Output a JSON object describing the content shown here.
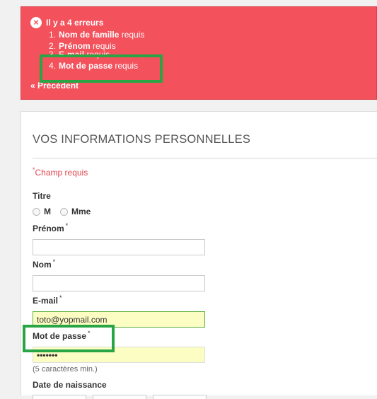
{
  "errors": {
    "header": "Il y a 4 erreurs",
    "items": [
      {
        "num": "1.",
        "field": "Nom de famille",
        "suffix": " requis"
      },
      {
        "num": "2.",
        "field": "Prénom",
        "suffix": " requis"
      },
      {
        "num": "3.",
        "field": "E-mail",
        "suffix": " requis"
      },
      {
        "num": "4.",
        "field": "Mot de passe",
        "suffix": " requis"
      }
    ],
    "back_link": "« Précédent"
  },
  "form": {
    "title": "VOS INFORMATIONS PERSONNELLES",
    "required_note_star": "*",
    "required_note": "Champ requis",
    "titre_label": "Titre",
    "radio_m": "M",
    "radio_mme": "Mme",
    "prenom_label": "Prénom",
    "nom_label": "Nom",
    "email_label": "E-mail",
    "email_value": "toto@yopmail.com",
    "password_label": "Mot de passe",
    "password_value": "•••••••",
    "password_hint": "(5 caractères min.)",
    "dob_label": "Date de naissance",
    "star": "*"
  },
  "colors": {
    "error_bg": "#f3515c",
    "annotation": "#2aa545",
    "filled_field_bg": "#fbfdc2",
    "valid_border": "#5cae3e"
  }
}
